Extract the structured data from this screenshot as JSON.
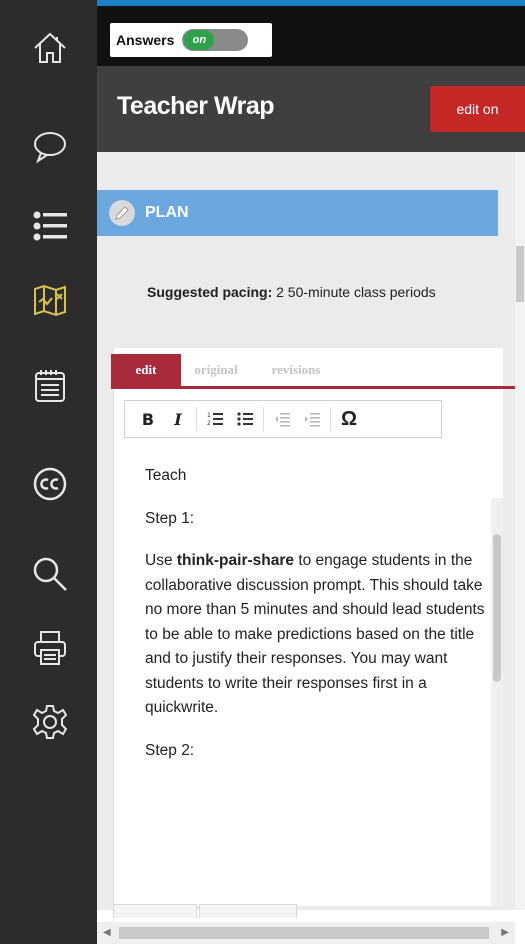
{
  "answers": {
    "label": "Answers",
    "state": "on"
  },
  "header": {
    "title": "Teacher Wrap",
    "edit_button": "edit on"
  },
  "plan": {
    "label": "PLAN"
  },
  "pacing": {
    "label": "Suggested pacing:",
    "value": " 2 50-minute class periods"
  },
  "tabs": {
    "edit": "edit",
    "original": "original",
    "revisions": "revisions"
  },
  "toolbar": {
    "bold": "B",
    "italic": "I",
    "ordered": "1≡",
    "unordered": "•≡",
    "outdent": "⇤≡",
    "indent": "⇥≡",
    "special": "Ω"
  },
  "editor": {
    "p1": "Teach",
    "p2": "Step 1:",
    "p3_bold": "think-pair-share",
    "p3_pre": "Use ",
    "p3_post": " to engage students in the collaborative discussion prompt. This should take no more than 5 minutes and should lead students to be able to make predictions based on the title and to justify their responses. You may want students to write their responses first in a quickwrite.",
    "p4": "Step 2:"
  },
  "rail_icons": [
    "home-icon",
    "chat-icon",
    "list-icon",
    "map-icon",
    "calendar-icon",
    "cc-icon",
    "search-icon",
    "print-icon",
    "gear-icon"
  ],
  "colors": {
    "rail": "#2c2c2c",
    "accent_red": "#c62828",
    "tab_red": "#a72b3b",
    "plan_blue": "#6aa8df",
    "map_yellow": "#d8c24a",
    "toggle_green": "#2ba14a"
  }
}
